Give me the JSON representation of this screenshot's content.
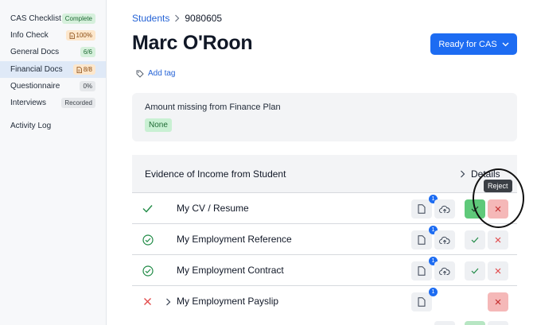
{
  "sidebar": {
    "items": [
      {
        "label": "CAS Checklist",
        "badge": "Complete"
      },
      {
        "label": "Info Check",
        "badge": "100%"
      },
      {
        "label": "General Docs",
        "badge": "6/6"
      },
      {
        "label": "Financial Docs",
        "badge": "8/8"
      },
      {
        "label": "Questionnaire",
        "badge": "0%"
      },
      {
        "label": "Interviews",
        "badge": "Recorded"
      }
    ],
    "activity_log": "Activity Log"
  },
  "breadcrumb": {
    "parent": "Students",
    "current": "9080605"
  },
  "student": {
    "first_name": "Marc",
    "last_name": "O'Roon"
  },
  "ready_button": "Ready for CAS",
  "add_tag": "Add tag",
  "finance": {
    "label": "Amount missing from Finance Plan",
    "value": "None"
  },
  "section": {
    "title": "Evidence of Income from Student",
    "details": "Details"
  },
  "rows": [
    {
      "name": "My CV / Resume",
      "doc_count": "1"
    },
    {
      "name": "My Employment Reference",
      "doc_count": "1"
    },
    {
      "name": "My Employment Contract",
      "doc_count": "1"
    },
    {
      "name": "My Employment Payslip",
      "doc_count": "1"
    }
  ],
  "tooltip": "Reject",
  "colors": {
    "accent": "#1d6cf2",
    "approve": "#5fc97a",
    "reject": "#e24b4b",
    "success": "#1f8a45"
  }
}
